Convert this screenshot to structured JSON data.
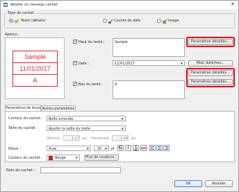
{
  "window": {
    "title": "Ajouter un nouveau cachet",
    "close_glyph": "✕"
  },
  "stamp_type": {
    "legend": "Type de cachet",
    "options": [
      {
        "label": "Texte (détails)",
        "selected": true,
        "icon": "text-stamp-icon"
      },
      {
        "label": "Cachet de date",
        "selected": false,
        "icon": "date-stamp-icon"
      },
      {
        "label": "Image",
        "selected": false,
        "icon": "image-stamp-icon"
      }
    ]
  },
  "preview": {
    "legend": "Aperçu :",
    "top_text": "Sample",
    "date_text": "11/01/2017",
    "bottom_text": "A",
    "color": "#d2252c"
  },
  "top_text": {
    "label": "Haut du texte :",
    "value": "Sample",
    "settings_button": "Paramètres détaillés..."
  },
  "date": {
    "label": "Date :",
    "value": "11/01/2017",
    "format_button": "Mod. date/heu...",
    "settings_button": "Paramètres détaillés..."
  },
  "bottom_text": {
    "label": "Bas du texte :",
    "value": "A",
    "settings_button": "Paramètres détaillés..."
  },
  "tabs": [
    {
      "label": "Paramètres de base",
      "active": true
    },
    {
      "label": "Autres paramètres",
      "active": false
    }
  ],
  "basic": {
    "outline_label": "Contour du cachet :",
    "outline_value": "Boîte arrondie",
    "size_label": "Taille du cachet :",
    "size_value": "Ajuster la taille du texte",
    "vertical_label": "Vertical :",
    "vertical_value": "1,17",
    "vertical_unit": "po",
    "horizontal_label": "Horizontal :",
    "horizontal_value": "1,49",
    "horizontal_unit": "po",
    "font_label": "Police :",
    "font_value": "Arial",
    "font_size": "20",
    "font_size_unit": "pt",
    "bold": "G",
    "italic": "I",
    "underline": "S",
    "strike": "abc",
    "color_label": "Couleur du cachet :",
    "color_value": "Rouge",
    "color_hex": "#d2252c",
    "more_colors_button": "Plus de couleurs..."
  },
  "name": {
    "label": "Nom du cachet :",
    "value": ""
  },
  "footer": {
    "ok": "OK",
    "cancel": "Annuler"
  },
  "highlight_color": "#e0001b"
}
